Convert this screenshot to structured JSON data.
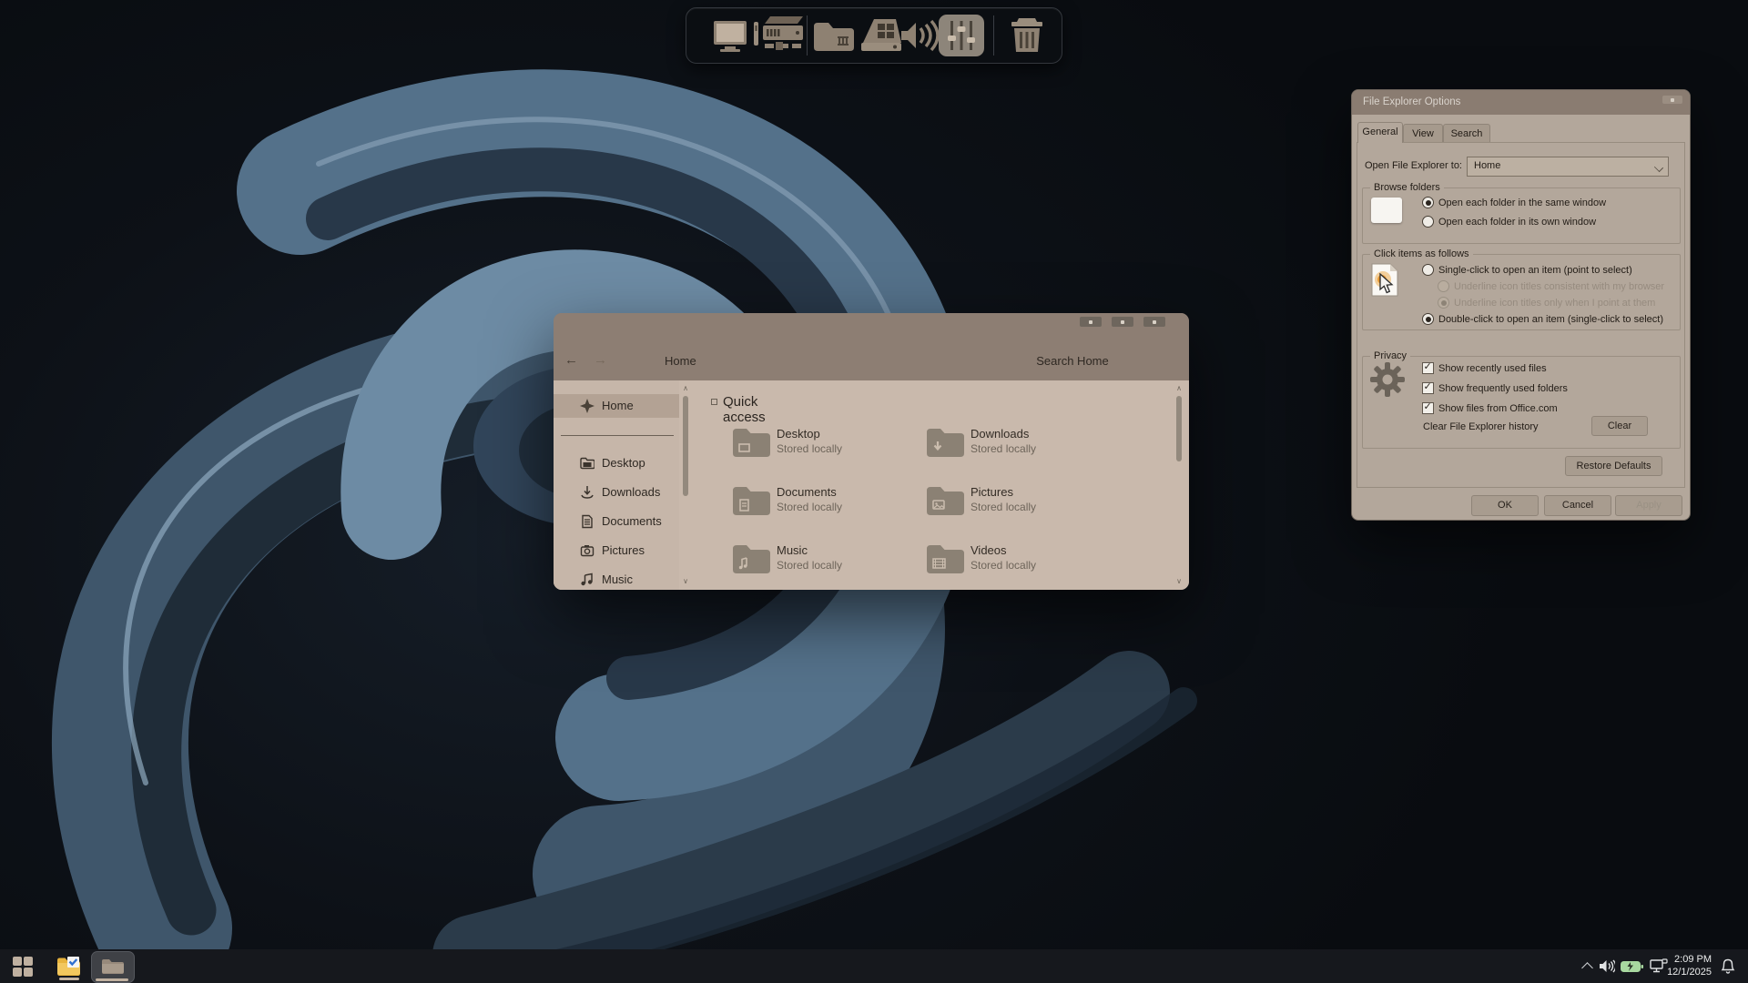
{
  "dock": {
    "icons": [
      "computer-monitor",
      "pc-tower",
      "folder",
      "drive-windows",
      "speaker",
      "mixer",
      "trash"
    ]
  },
  "explorer": {
    "nav": {
      "back": "←",
      "forward": "→",
      "location": "Home",
      "search": "Search Home"
    },
    "sidebar": {
      "items": [
        {
          "label": "Home",
          "selected": true
        },
        {
          "label": "Desktop",
          "selected": false
        },
        {
          "label": "Downloads",
          "selected": false
        },
        {
          "label": "Documents",
          "selected": false
        },
        {
          "label": "Pictures",
          "selected": false
        },
        {
          "label": "Music",
          "selected": false
        }
      ]
    },
    "content": {
      "section": "Quick access",
      "tiles": [
        {
          "title": "Desktop",
          "subtitle": "Stored locally"
        },
        {
          "title": "Downloads",
          "subtitle": "Stored locally"
        },
        {
          "title": "Documents",
          "subtitle": "Stored locally"
        },
        {
          "title": "Pictures",
          "subtitle": "Stored locally"
        },
        {
          "title": "Music",
          "subtitle": "Stored locally"
        },
        {
          "title": "Videos",
          "subtitle": "Stored locally"
        }
      ]
    }
  },
  "dialog": {
    "title": "File Explorer Options",
    "tabs": [
      {
        "label": "General",
        "active": true
      },
      {
        "label": "View",
        "active": false
      },
      {
        "label": "Search",
        "active": false
      }
    ],
    "open_to": {
      "label": "Open File Explorer to:",
      "value": "Home"
    },
    "browse_folders": {
      "legend": "Browse folders",
      "options": [
        {
          "label": "Open each folder in the same window",
          "selected": true
        },
        {
          "label": "Open each folder in its own window",
          "selected": false
        }
      ]
    },
    "click_items": {
      "legend": "Click items as follows",
      "options": [
        {
          "label": "Single-click to open an item (point to select)",
          "selected": false,
          "disabled": false
        },
        {
          "label": "Underline icon titles consistent with my browser",
          "selected": false,
          "disabled": true
        },
        {
          "label": "Underline icon titles only when I point at them",
          "selected": true,
          "disabled": true
        },
        {
          "label": "Double-click to open an item (single-click to select)",
          "selected": true,
          "disabled": false
        }
      ]
    },
    "privacy": {
      "legend": "Privacy",
      "checkboxes": [
        {
          "label": "Show recently used files",
          "checked": true
        },
        {
          "label": "Show frequently used folders",
          "checked": true
        },
        {
          "label": "Show files from Office.com",
          "checked": true
        }
      ],
      "clear_label": "Clear File Explorer history",
      "clear_button": "Clear"
    },
    "buttons": {
      "restore": "Restore Defaults",
      "ok": "OK",
      "cancel": "Cancel",
      "apply": "Apply"
    }
  },
  "taskbar": {
    "tray": {
      "time": "2:09 PM",
      "date": "12/1/2025"
    }
  },
  "colors": {
    "dialog_body": "#b3a79b",
    "dialog_titlebar": "#8a7c71",
    "explorer_titlebar": "#8d7e73",
    "explorer_body": "#c9b9ac",
    "sidebar_highlight": "#b3a294",
    "battery_green": "#a8d8a0",
    "folder_yellow": "#e8b33c",
    "check_blue": "#2f6fd0"
  }
}
